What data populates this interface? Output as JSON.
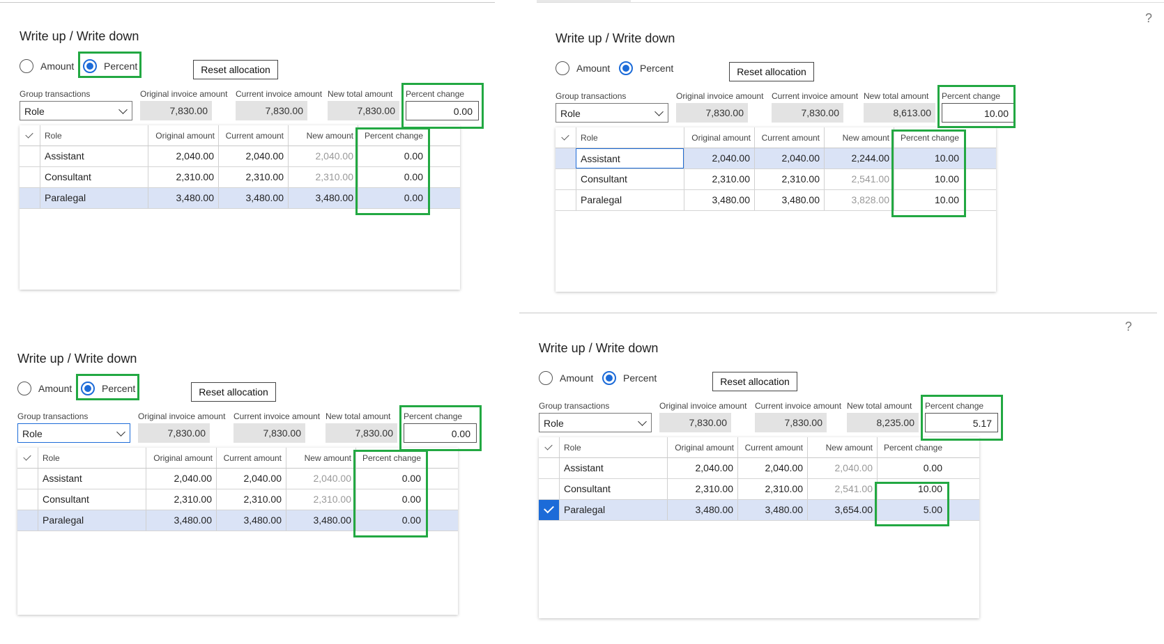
{
  "help_icon": "?",
  "labels": {
    "title": "Write up / Write down",
    "amount": "Amount",
    "percent": "Percent",
    "reset": "Reset allocation",
    "group_tx": "Group transactions",
    "orig_inv": "Original invoice amount",
    "curr_inv": "Current invoice amount",
    "new_total": "New total amount",
    "pct_change": "Percent change",
    "col_role": "Role",
    "col_orig": "Original amount",
    "col_curr": "Current amount",
    "col_new": "New amount",
    "col_pct": "Percent change"
  },
  "colors": {
    "accent": "#1c6bd8",
    "highlight": "#22a842",
    "selected_row": "#dae3f6"
  },
  "panels": [
    {
      "group_value": "Role",
      "orig_total": "7,830.00",
      "curr_total": "7,830.00",
      "new_total": "7,830.00",
      "pct_change": "0.00",
      "rows": [
        {
          "role": "Assistant",
          "orig": "2,040.00",
          "curr": "2,040.00",
          "new": "2,040.00",
          "pct": "0.00"
        },
        {
          "role": "Consultant",
          "orig": "2,310.00",
          "curr": "2,310.00",
          "new": "2,310.00",
          "pct": "0.00"
        },
        {
          "role": "Paralegal",
          "orig": "3,480.00",
          "curr": "3,480.00",
          "new": "3,480.00",
          "pct": "0.00"
        }
      ]
    },
    {
      "group_value": "Role",
      "orig_total": "7,830.00",
      "curr_total": "7,830.00",
      "new_total": "8,613.00",
      "pct_change": "10.00",
      "rows": [
        {
          "role": "Assistant",
          "orig": "2,040.00",
          "curr": "2,040.00",
          "new": "2,244.00",
          "pct": "10.00"
        },
        {
          "role": "Consultant",
          "orig": "2,310.00",
          "curr": "2,310.00",
          "new": "2,541.00",
          "pct": "10.00"
        },
        {
          "role": "Paralegal",
          "orig": "3,480.00",
          "curr": "3,480.00",
          "new": "3,828.00",
          "pct": "10.00"
        }
      ]
    },
    {
      "group_value": "Role",
      "orig_total": "7,830.00",
      "curr_total": "7,830.00",
      "new_total": "7,830.00",
      "pct_change": "0.00",
      "rows": [
        {
          "role": "Assistant",
          "orig": "2,040.00",
          "curr": "2,040.00",
          "new": "2,040.00",
          "pct": "0.00"
        },
        {
          "role": "Consultant",
          "orig": "2,310.00",
          "curr": "2,310.00",
          "new": "2,310.00",
          "pct": "0.00"
        },
        {
          "role": "Paralegal",
          "orig": "3,480.00",
          "curr": "3,480.00",
          "new": "3,480.00",
          "pct": "0.00"
        }
      ]
    },
    {
      "group_value": "Role",
      "orig_total": "7,830.00",
      "curr_total": "7,830.00",
      "new_total": "8,235.00",
      "pct_change": "5.17",
      "rows": [
        {
          "role": "Assistant",
          "orig": "2,040.00",
          "curr": "2,040.00",
          "new": "2,040.00",
          "pct": "0.00"
        },
        {
          "role": "Consultant",
          "orig": "2,310.00",
          "curr": "2,310.00",
          "new": "2,541.00",
          "pct": "10.00"
        },
        {
          "role": "Paralegal",
          "orig": "3,480.00",
          "curr": "3,480.00",
          "new": "3,654.00",
          "pct": "5.00"
        }
      ]
    }
  ]
}
